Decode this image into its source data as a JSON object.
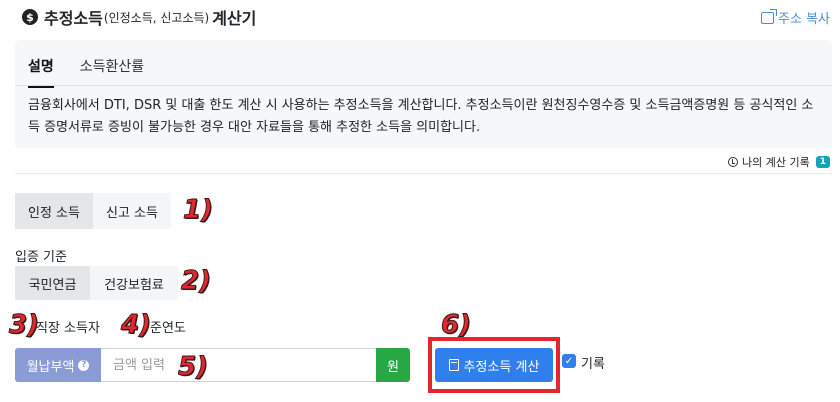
{
  "header": {
    "title_main": "추정소득",
    "title_sub": "(인정소득, 신고소득)",
    "title_tail": "계산기",
    "copy_link": "주소 복사",
    "title_icon": "dollar-coin-icon"
  },
  "info": {
    "tabs": [
      {
        "label": "설명",
        "active": true
      },
      {
        "label": "소득환산률",
        "active": false
      }
    ],
    "description": "금융회사에서 DTI, DSR 및 대출 한도 계산 시 사용하는 추정소득을 계산합니다. 추정소득이란 원천징수영수증 및 소득금액증명원 등 공식적인 소득 증명서류로 증빙이 불가능한 경우 대안 자료들을 통해 추정한 소득을 의미합니다."
  },
  "history": {
    "label": "나의 계산 기록",
    "count": "1"
  },
  "income_type": {
    "options": [
      "인정 소득",
      "신고 소득"
    ],
    "selected": "인정 소득"
  },
  "basis": {
    "label": "입증 기준",
    "options": [
      "국민연금",
      "건강보험료"
    ],
    "selected": "국민연금"
  },
  "row_labels": {
    "left": "직장 소득자",
    "right": "준연도"
  },
  "amount": {
    "prefix": "월납부액",
    "placeholder": "금액 입력",
    "unit": "원"
  },
  "calc_button": "추정소득 계산",
  "record_label": "기록",
  "annotations": [
    "1)",
    "2)",
    "3)",
    "4)",
    "5)",
    "6)"
  ],
  "colors": {
    "primary": "#2f80ed",
    "prefix": "#8a9bd6",
    "unit_bg": "#28a745",
    "annotation": "#e5262e",
    "badge": "#17a2b8"
  }
}
